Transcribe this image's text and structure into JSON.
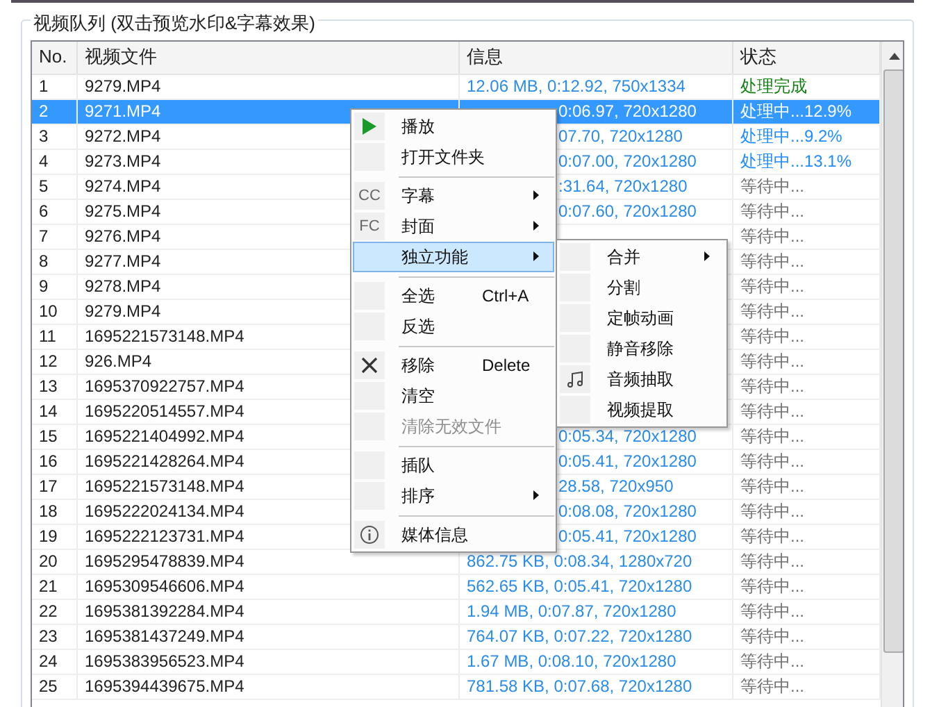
{
  "group_title": "视频队列 (双击预览水印&字幕效果)",
  "table": {
    "columns": [
      "No.",
      "视频文件",
      "信息",
      "状态"
    ],
    "rows": [
      {
        "no": "1",
        "file": "9279.MP4",
        "info": "12.06 MB, 0:12.92, 750x1334",
        "status": "处理完成",
        "kind": "done",
        "selected": false,
        "info_clipped": false
      },
      {
        "no": "2",
        "file": "9271.MP4",
        "info": "0:06.97, 720x1280",
        "status": "处理中...12.9%",
        "kind": "processing",
        "selected": true,
        "info_clipped": true
      },
      {
        "no": "3",
        "file": "9272.MP4",
        "info": "07.70, 720x1280",
        "status": "处理中...9.2%",
        "kind": "processing",
        "selected": false,
        "info_clipped": true
      },
      {
        "no": "4",
        "file": "9273.MP4",
        "info": "0:07.00, 720x1280",
        "status": "处理中...13.1%",
        "kind": "processing",
        "selected": false,
        "info_clipped": true
      },
      {
        "no": "5",
        "file": "9274.MP4",
        "info": ":31.64, 720x1280",
        "status": "等待中...",
        "kind": "waiting",
        "selected": false,
        "info_clipped": true
      },
      {
        "no": "6",
        "file": "9275.MP4",
        "info": "0:07.60, 720x1280",
        "status": "等待中...",
        "kind": "waiting",
        "selected": false,
        "info_clipped": true
      },
      {
        "no": "7",
        "file": "9276.MP4",
        "status": "等待中...",
        "kind": "waiting",
        "selected": false
      },
      {
        "no": "8",
        "file": "9277.MP4",
        "status": "等待中...",
        "kind": "waiting",
        "selected": false
      },
      {
        "no": "9",
        "file": "9278.MP4",
        "status": "等待中...",
        "kind": "waiting",
        "selected": false
      },
      {
        "no": "10",
        "file": "9279.MP4",
        "status": "等待中...",
        "kind": "waiting",
        "selected": false
      },
      {
        "no": "11",
        "file": "1695221573148.MP4",
        "status": "等待中...",
        "kind": "waiting",
        "selected": false
      },
      {
        "no": "12",
        "file": "926.MP4",
        "status": "等待中...",
        "kind": "waiting",
        "selected": false
      },
      {
        "no": "13",
        "file": "1695370922757.MP4",
        "status": "等待中...",
        "kind": "waiting",
        "selected": false
      },
      {
        "no": "14",
        "file": "1695220514557.MP4",
        "status": "等待中...",
        "kind": "waiting",
        "selected": false
      },
      {
        "no": "15",
        "file": "1695221404992.MP4",
        "info": "0:05.34, 720x1280",
        "status": "等待中...",
        "kind": "waiting",
        "selected": false,
        "info_clipped": true
      },
      {
        "no": "16",
        "file": "1695221428264.MP4",
        "info": "0:05.41, 720x1280",
        "status": "等待中...",
        "kind": "waiting",
        "selected": false,
        "info_clipped": true
      },
      {
        "no": "17",
        "file": "1695221573148.MP4",
        "info": "28.58, 720x950",
        "status": "等待中...",
        "kind": "waiting",
        "selected": false,
        "info_clipped": true
      },
      {
        "no": "18",
        "file": "1695222024134.MP4",
        "info": "0:08.08, 720x1280",
        "status": "等待中...",
        "kind": "waiting",
        "selected": false,
        "info_clipped": true
      },
      {
        "no": "19",
        "file": "1695222123731.MP4",
        "info": "0:05.41, 720x1280",
        "status": "等待中...",
        "kind": "waiting",
        "selected": false,
        "info_clipped": true
      },
      {
        "no": "20",
        "file": "1695295478839.MP4",
        "info": "862.75 KB, 0:08.34, 1280x720",
        "status": "等待中...",
        "kind": "waiting",
        "selected": false,
        "info_clipped": false
      },
      {
        "no": "21",
        "file": "1695309546606.MP4",
        "info": "562.65 KB, 0:05.41, 720x1280",
        "status": "等待中...",
        "kind": "waiting",
        "selected": false,
        "info_clipped": false
      },
      {
        "no": "22",
        "file": "1695381392284.MP4",
        "info": "1.94 MB, 0:07.87, 720x1280",
        "status": "等待中...",
        "kind": "waiting",
        "selected": false,
        "info_clipped": false
      },
      {
        "no": "23",
        "file": "1695381437249.MP4",
        "info": "764.07 KB, 0:07.22, 720x1280",
        "status": "等待中...",
        "kind": "waiting",
        "selected": false,
        "info_clipped": false
      },
      {
        "no": "24",
        "file": "1695383956523.MP4",
        "info": "1.67 MB, 0:08.10, 720x1280",
        "status": "等待中...",
        "kind": "waiting",
        "selected": false,
        "info_clipped": false
      },
      {
        "no": "25",
        "file": "1695394439675.MP4",
        "info": "781.58 KB, 0:07.68, 720x1280",
        "status": "等待中...",
        "kind": "waiting",
        "selected": false,
        "info_clipped": false
      }
    ]
  },
  "context_menu": [
    {
      "kind": "item",
      "label": "播放",
      "submenu": false,
      "highlighted": false,
      "disabled": false
    },
    {
      "kind": "item",
      "label": "打开文件夹",
      "submenu": false,
      "highlighted": false,
      "disabled": false
    },
    {
      "kind": "separator"
    },
    {
      "kind": "item",
      "label": "字幕",
      "icon_text": "CC",
      "submenu": true,
      "highlighted": false,
      "disabled": false
    },
    {
      "kind": "item",
      "label": "封面",
      "icon_text": "FC",
      "submenu": true,
      "highlighted": false,
      "disabled": false
    },
    {
      "kind": "item",
      "label": "独立功能",
      "submenu": true,
      "highlighted": true,
      "disabled": false
    },
    {
      "kind": "separator"
    },
    {
      "kind": "item",
      "label": "全选",
      "shortcut": "Ctrl+A",
      "submenu": false,
      "highlighted": false,
      "disabled": false
    },
    {
      "kind": "item",
      "label": "反选",
      "submenu": false,
      "highlighted": false,
      "disabled": false
    },
    {
      "kind": "separator"
    },
    {
      "kind": "item",
      "label": "移除",
      "shortcut": "Delete",
      "submenu": false,
      "highlighted": false,
      "disabled": false
    },
    {
      "kind": "item",
      "label": "清空",
      "submenu": false,
      "highlighted": false,
      "disabled": false
    },
    {
      "kind": "item",
      "label": "清除无效文件",
      "submenu": false,
      "highlighted": false,
      "disabled": true
    },
    {
      "kind": "separator"
    },
    {
      "kind": "item",
      "label": "插队",
      "submenu": false,
      "highlighted": false,
      "disabled": false
    },
    {
      "kind": "item",
      "label": "排序",
      "submenu": true,
      "highlighted": false,
      "disabled": false
    },
    {
      "kind": "separator"
    },
    {
      "kind": "item",
      "label": "媒体信息",
      "submenu": false,
      "highlighted": false,
      "disabled": false
    }
  ],
  "submenu": [
    {
      "kind": "item",
      "label": "合并",
      "submenu": true
    },
    {
      "kind": "item",
      "label": "分割",
      "submenu": false
    },
    {
      "kind": "item",
      "label": "定帧动画",
      "submenu": false
    },
    {
      "kind": "item",
      "label": "静音移除",
      "submenu": false
    },
    {
      "kind": "item",
      "label": "音频抽取",
      "submenu": false
    },
    {
      "kind": "item",
      "label": "视频提取",
      "submenu": false
    }
  ]
}
